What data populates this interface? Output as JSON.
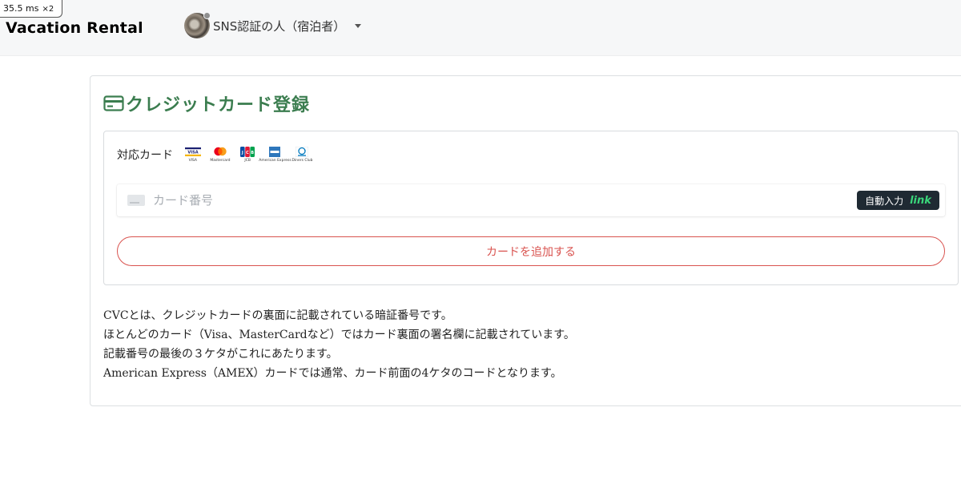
{
  "perf": {
    "time": "35.5 ms",
    "multiplier": "×2"
  },
  "header": {
    "brand": "Vacation Rental",
    "user": {
      "name": "SNS認証の人（宿泊者）"
    }
  },
  "page": {
    "title": "クレジットカード登録",
    "supported_label": "対応カード",
    "brands": [
      {
        "name": "VISA",
        "color": "#1a1f71"
      },
      {
        "name": "Mastercard",
        "color": "#eb001b"
      },
      {
        "name": "JCB",
        "color": "#0b4ea2"
      },
      {
        "name": "American Express",
        "color": "#2e77bc"
      },
      {
        "name": "Diners Club",
        "color": "#0079be"
      }
    ],
    "card_input": {
      "placeholder": "カード番号",
      "value": ""
    },
    "autofill": {
      "label": "自動入力",
      "link_word": "link"
    },
    "add_button": "カードを追加する",
    "cvc_lines": [
      "CVCとは、クレジットカードの裏面に記載されている暗証番号です。",
      "ほとんどのカード（Visa、MasterCardなど）ではカード裏面の署名欄に記載されています。",
      "記載番号の最後の３ケタがこれにあたります。",
      "American Express（AMEX）カードでは通常、カード前面の4ケタのコードとなります。"
    ]
  },
  "colors": {
    "accent_green": "#3b7d4f",
    "danger_red": "#d9534f",
    "link_green": "#39d67a"
  }
}
